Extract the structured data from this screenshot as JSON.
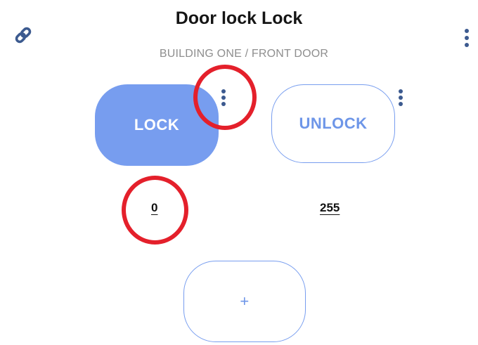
{
  "header": {
    "title": "Door lock Lock",
    "breadcrumb": "BUILDING ONE / FRONT DOOR",
    "link_icon": "link-icon",
    "menu_icon": "more-vertical-icon"
  },
  "actions": [
    {
      "label": "LOCK",
      "value": "0",
      "state": "active"
    },
    {
      "label": "UNLOCK",
      "value": "255",
      "state": "inactive"
    }
  ],
  "add_button": {
    "label": "+"
  },
  "annotations": {
    "highlight_color": "#e4202b"
  },
  "colors": {
    "accent": "#779def",
    "accent_text": "#6e96e8",
    "icon": "#3c5a8f",
    "title": "#151515",
    "breadcrumb": "#8e8e8e"
  }
}
